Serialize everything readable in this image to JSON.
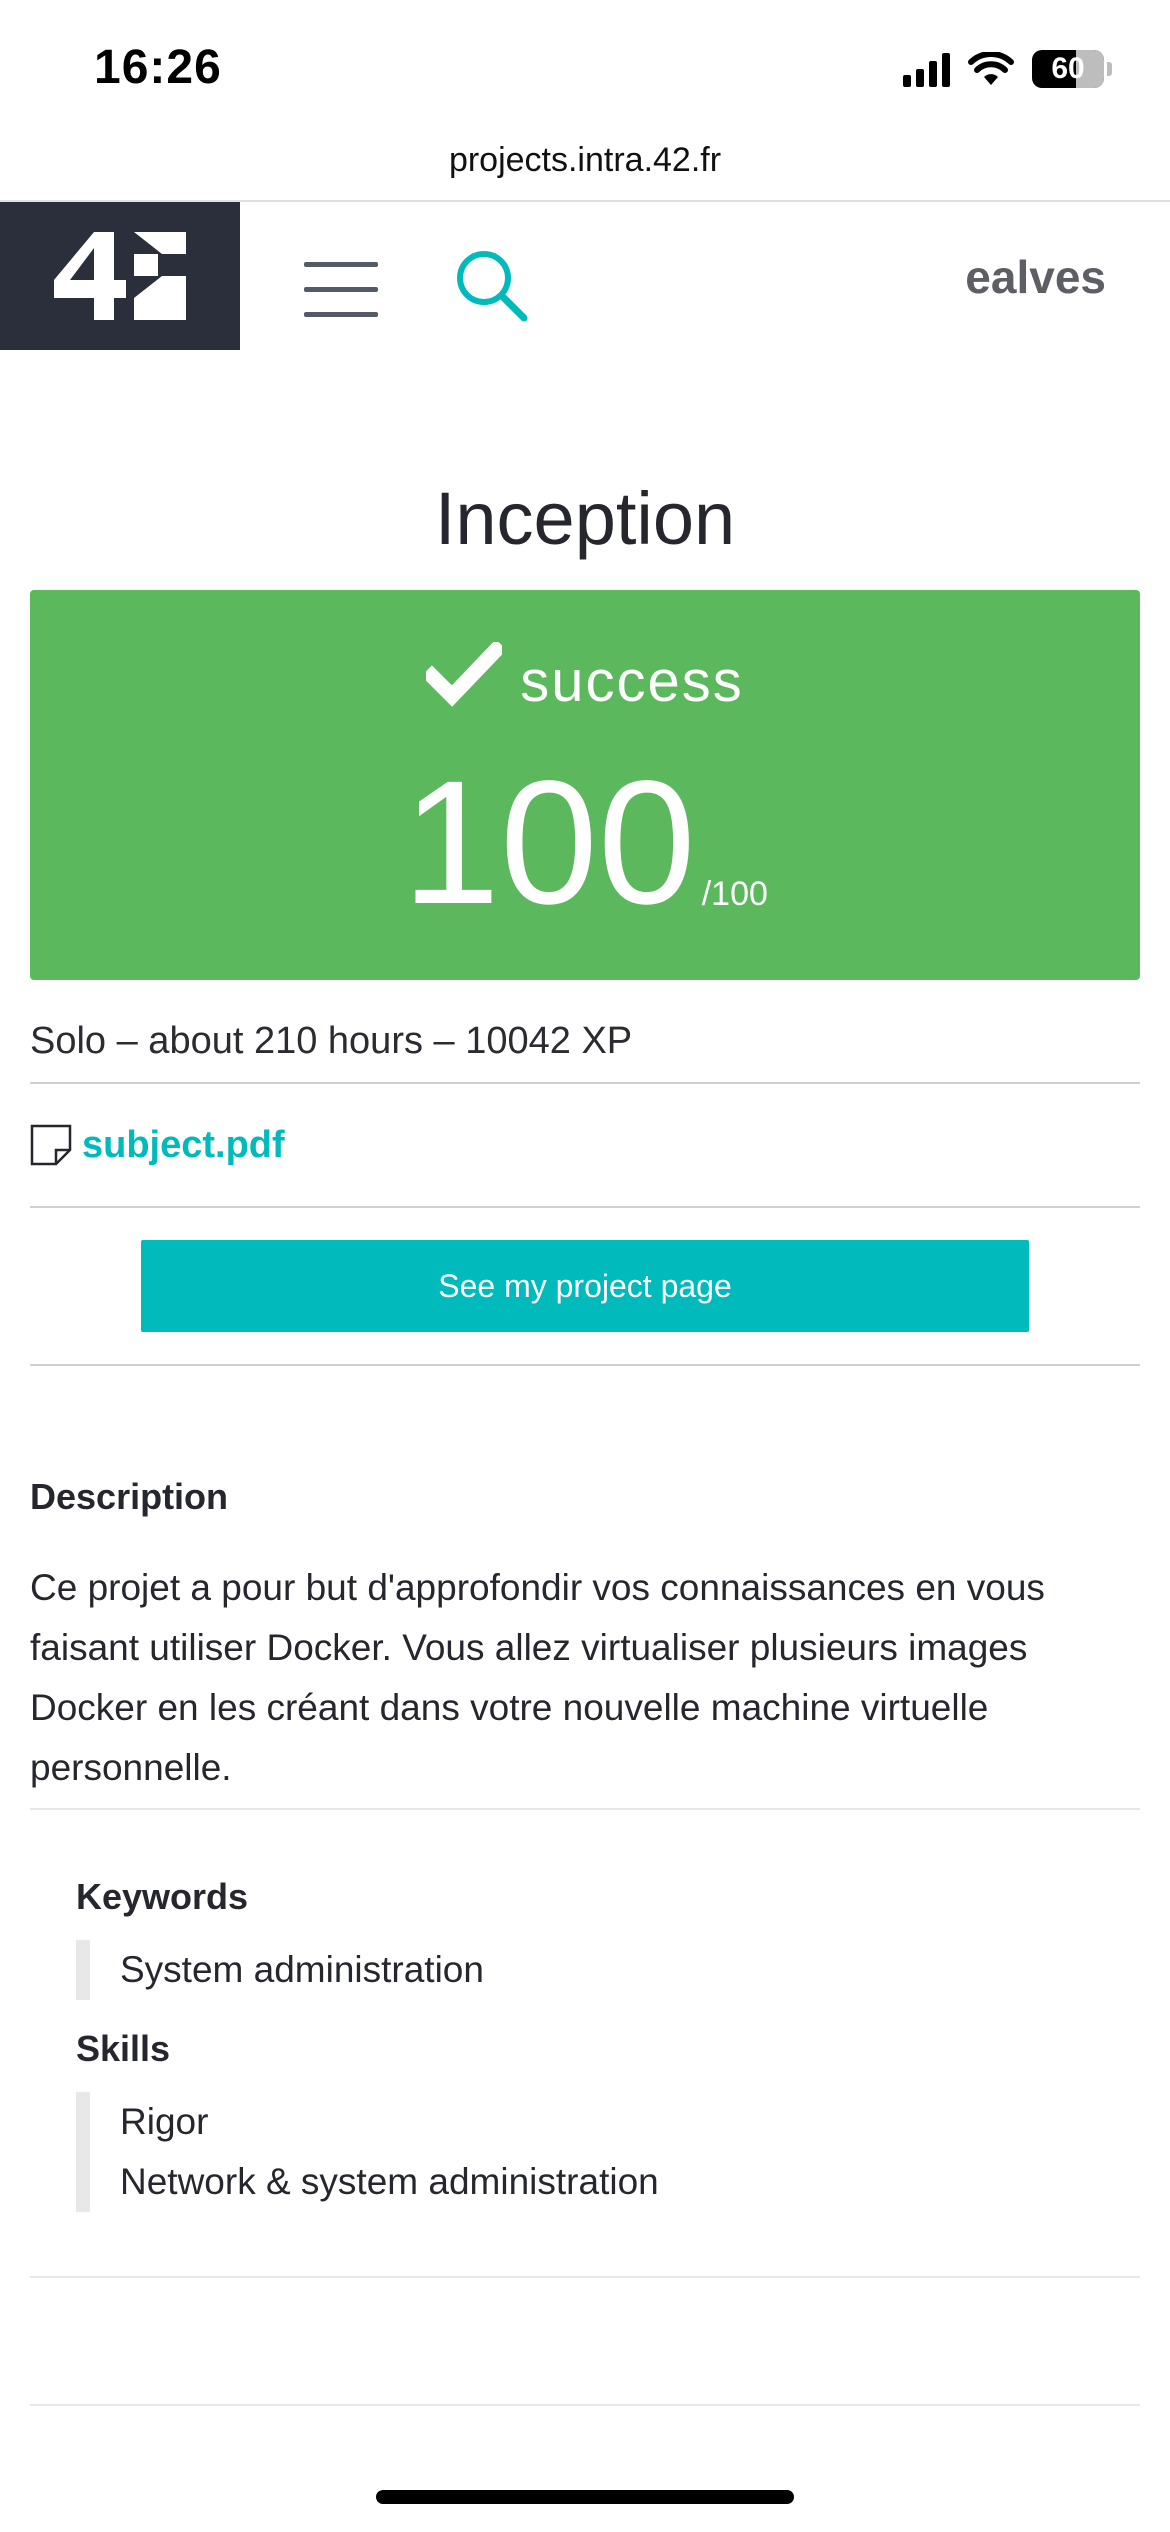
{
  "status_bar": {
    "time": "16:26",
    "battery_level": "60"
  },
  "browser": {
    "url": "projects.intra.42.fr"
  },
  "header": {
    "logo_text": "42",
    "username": "ealves"
  },
  "project": {
    "title": "Inception",
    "status": "success",
    "score": "100",
    "score_max": "/100",
    "meta": "Solo – about 210 hours – 10042 XP",
    "subject_file": "subject.pdf",
    "project_page_button": "See my project page"
  },
  "description": {
    "title": "Description",
    "text": "Ce projet a pour but d'approfondir vos connaissances en vous faisant utiliser Docker. Vous allez virtualiser plusieurs images Docker en les créant dans votre nouvelle machine virtuelle personnelle."
  },
  "keywords": {
    "title": "Keywords",
    "items": [
      "System administration"
    ]
  },
  "skills": {
    "title": "Skills",
    "items": [
      "Rigor",
      "Network & system administration"
    ]
  },
  "colors": {
    "success": "#5cb85c",
    "accent": "#00babc",
    "header_dark": "#2b2f3b"
  }
}
